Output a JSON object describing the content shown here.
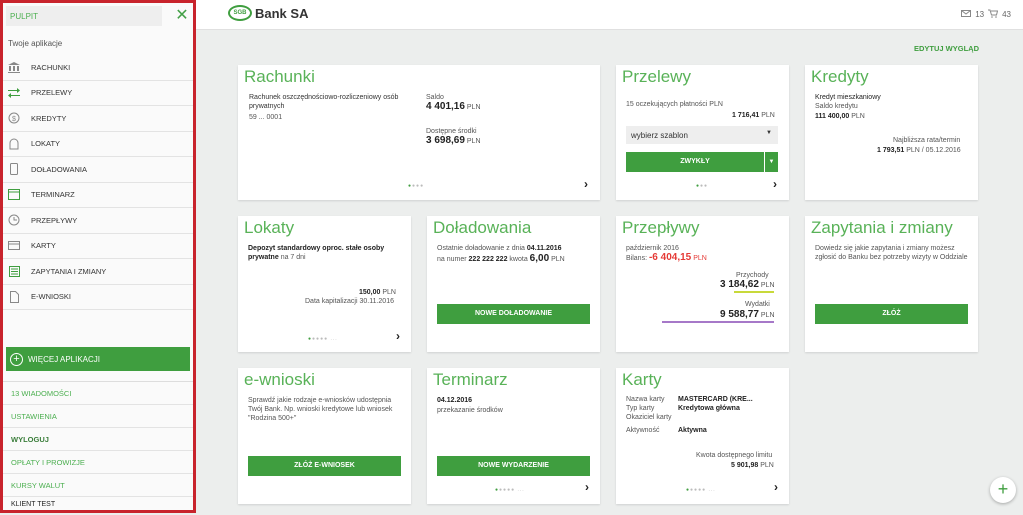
{
  "sidebar": {
    "search_label": "PULPIT",
    "section_label": "Twoje aplikacje",
    "items": [
      {
        "label": "RACHUNKI",
        "icon": "bank-icon"
      },
      {
        "label": "PRZELEWY",
        "icon": "transfer-icon"
      },
      {
        "label": "KREDYTY",
        "icon": "coin-icon"
      },
      {
        "label": "LOKATY",
        "icon": "deposit-icon"
      },
      {
        "label": "DOŁADOWANIA",
        "icon": "phone-icon"
      },
      {
        "label": "TERMINARZ",
        "icon": "calendar-icon"
      },
      {
        "label": "PRZEPŁYWY",
        "icon": "clock-icon"
      },
      {
        "label": "KARTY",
        "icon": "card-icon"
      },
      {
        "label": "ZAPYTANIA I ZMIANY",
        "icon": "list-icon"
      },
      {
        "label": "E-WNIOSKI",
        "icon": "document-icon"
      }
    ],
    "more_apps": "WIĘCEJ APLIKACJI",
    "links": [
      "13 WIADOMOŚCI",
      "USTAWIENIA",
      "WYLOGUJ",
      "OPŁATY I PROWIZJE",
      "KURSY WALUT"
    ],
    "user": "KLIENT TEST"
  },
  "header": {
    "logo_mark": "SGB",
    "logo_text": "Bank SA",
    "messages_count": "13",
    "cart_count": "43"
  },
  "edit_layout": "EDYTUJ WYGLĄD",
  "colors": {
    "accent": "#3f9e3f",
    "title_green": "#59b258",
    "sidebar_border": "#c8232c",
    "negative": "#e53935"
  },
  "cards": {
    "rachunki": {
      "title": "Rachunki",
      "account_name": "Rachunek oszczędnościowo-rozliczeniowy osób prywatnych",
      "account_no": "59 ... 0001",
      "saldo_label": "Saldo",
      "saldo": "4 401,16",
      "available_label": "Dostępne środki",
      "available": "3 698,69",
      "currency": "PLN"
    },
    "przelewy": {
      "title": "Przelewy",
      "pending": "15 oczekujących płatności PLN",
      "pending_amount": "1 716,41",
      "currency": "PLN",
      "template_select": "wybierz szablon",
      "button": "ZWYKŁY"
    },
    "kredyty": {
      "title": "Kredyty",
      "name": "Kredyt mieszkaniowy",
      "balance_label": "Saldo kredytu",
      "balance": "111 400,00",
      "currency": "PLN",
      "next_label": "Najbliższa rata/termin",
      "next_value": "1 793,51",
      "next_date": "/ 05.12.2016"
    },
    "lokaty": {
      "title": "Lokaty",
      "name": "Depozyt standardowy oproc. stałe osoby prywatne",
      "term": "na 7 dni",
      "amount": "150,00",
      "currency": "PLN",
      "cap_date": "Data kapitalizacji 30.11.2016"
    },
    "doladowania": {
      "title": "Doładowania",
      "last_label": "Ostatnie doładowanie z dnia",
      "last_date": "04.11.2016",
      "number_label": "na numer",
      "number": "222 222 222",
      "amount_label": "kwota",
      "amount": "6,00",
      "currency": "PLN",
      "button": "NOWE DOŁADOWANIE"
    },
    "przeplywy": {
      "title": "Przepływy",
      "month": "październik 2016",
      "balance_label": "Bilans:",
      "balance": "-6 404,15",
      "currency": "PLN",
      "income_label": "Przychody",
      "income": "3 184,62",
      "expense_label": "Wydatki",
      "expense": "9 588,77"
    },
    "zapytania": {
      "title": "Zapytania i zmiany",
      "text": "Dowiedz się jakie zapytania i zmiany możesz zgłosić do Banku bez potrzeby wizyty w Oddziale",
      "button": "ZŁÓŻ"
    },
    "ewnioski": {
      "title": "e-wnioski",
      "text": "Sprawdź jakie rodzaje e-wniosków udostępnia Twój Bank. Np. wnioski kredytowe lub wniosek \"Rodzina 500+\"",
      "button": "ZŁÓŻ E-WNIOSEK"
    },
    "terminarz": {
      "title": "Terminarz",
      "date": "04.12.2016",
      "desc": "przekazanie środków",
      "button": "NOWE WYDARZENIE"
    },
    "karty": {
      "title": "Karty",
      "l1": "Nazwa karty",
      "v1": "MASTERCARD (KRE...",
      "l2": "Typ karty",
      "v2": "Kredytowa główna",
      "l3": "Okaziciel karty",
      "l4": "Aktywność",
      "v4": "Aktywna",
      "limit_label": "Kwota dostępnego limitu",
      "limit": "5 901,98",
      "currency": "PLN"
    }
  }
}
